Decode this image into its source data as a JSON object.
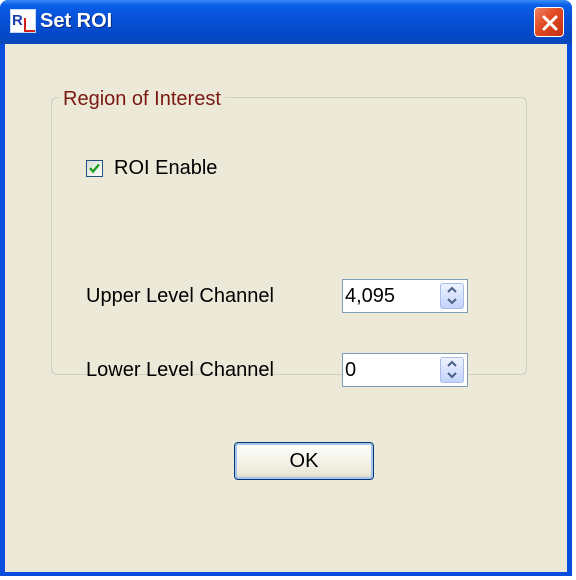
{
  "window": {
    "title": "Set ROI",
    "app_icon": "app-logo-icon",
    "close_icon": "close-icon",
    "accent_color": "#0a4ee0",
    "close_color": "#e04a22"
  },
  "group": {
    "legend": "Region of Interest",
    "legend_color": "#7a1a12"
  },
  "roi_enable": {
    "label": "ROI Enable",
    "checked": true
  },
  "upper_level": {
    "label": "Upper Level Channel",
    "value": "4,095"
  },
  "lower_level": {
    "label": "Lower Level Channel",
    "value": "0"
  },
  "ok_button": {
    "label": "OK"
  }
}
